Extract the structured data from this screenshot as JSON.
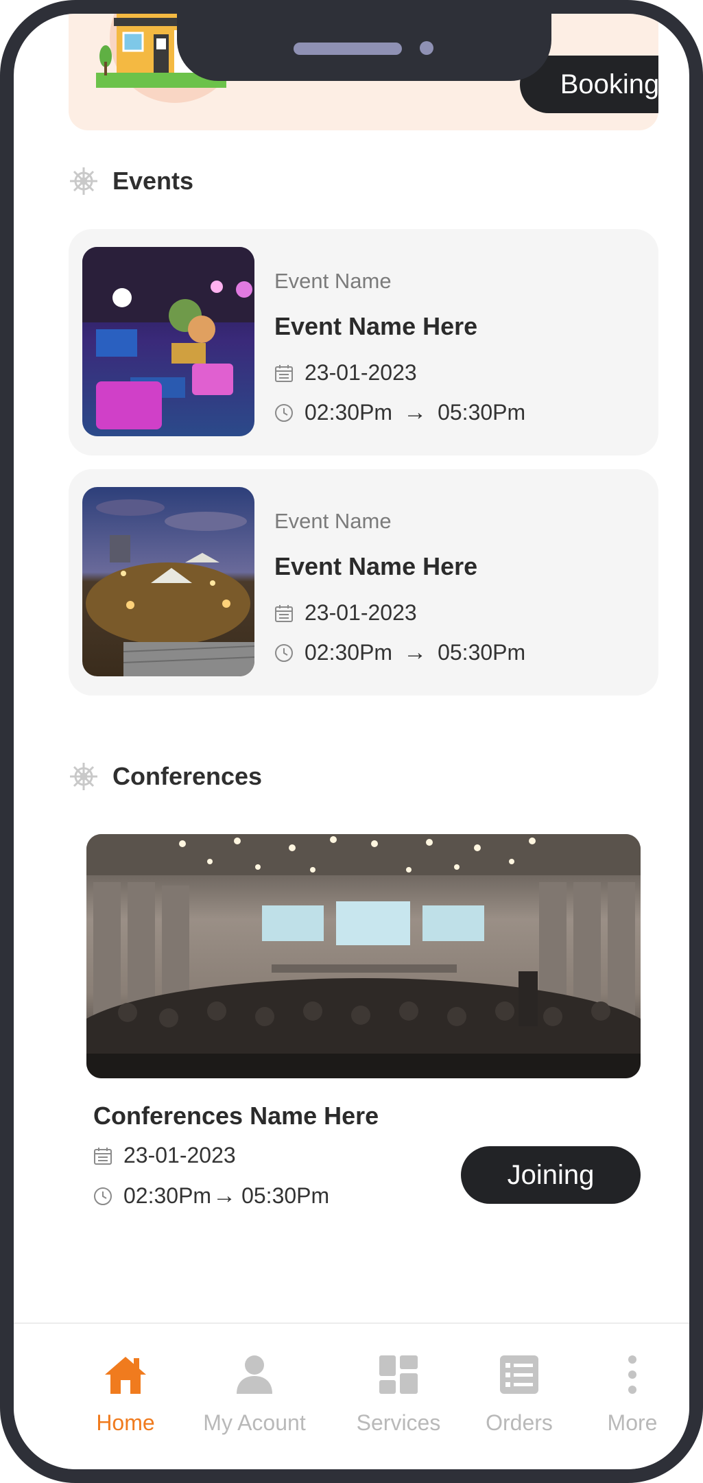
{
  "banner": {
    "booking_label": "Booking"
  },
  "sections": {
    "events_title": "Events",
    "conferences_title": "Conferences"
  },
  "events": [
    {
      "label": "Event Name",
      "name": "Event Name Here",
      "date": "23-01-2023",
      "start": "02:30Pm",
      "end": "05:30Pm",
      "image": "event-party-photo"
    },
    {
      "label": "Event Name",
      "name": "Event Name Here",
      "date": "23-01-2023",
      "start": "02:30Pm",
      "end": "05:30Pm",
      "image": "outdoor-festival-photo"
    }
  ],
  "conference": {
    "name": "Conferences Name Here",
    "date": "23-01-2023",
    "start": "02:30Pm",
    "end": "05:30Pm",
    "joining_label": "Joining",
    "image": "conference-hall-photo"
  },
  "nav": {
    "items": [
      {
        "label": "Home",
        "icon": "home-icon",
        "active": true
      },
      {
        "label": "My Acount",
        "icon": "user-icon",
        "active": false
      },
      {
        "label": "Services",
        "icon": "grid-icon",
        "active": false
      },
      {
        "label": "Orders",
        "icon": "list-icon",
        "active": false
      },
      {
        "label": "More",
        "icon": "more-vertical-icon",
        "active": false
      }
    ]
  },
  "colors": {
    "accent": "#f07b1e",
    "button_dark": "#222326",
    "card_bg": "#f5f5f5",
    "banner_bg": "#fdeee4"
  }
}
